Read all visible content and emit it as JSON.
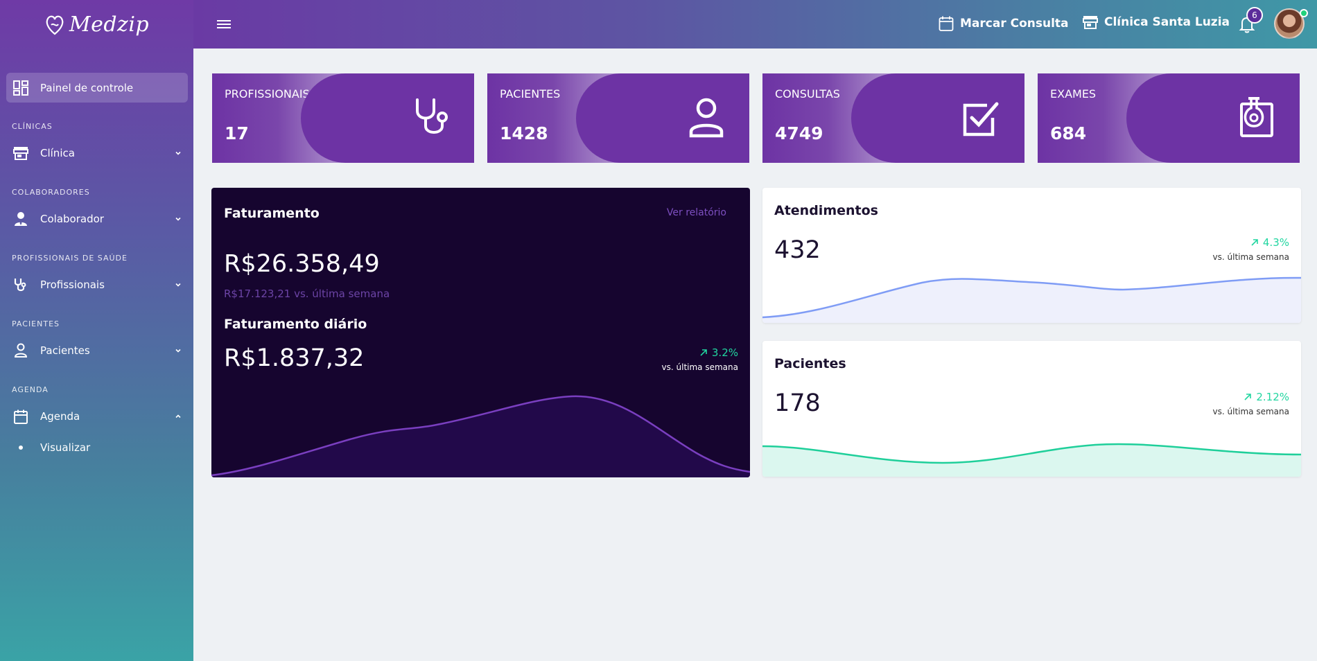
{
  "brand": {
    "name": "Medzip"
  },
  "sidebar": {
    "active": {
      "label": "Painel de controle",
      "icon": "dashboard-icon"
    },
    "sections": [
      {
        "title": "CLÍNICAS",
        "item": "Clínica",
        "icon": "store-icon"
      },
      {
        "title": "COLABORADORES",
        "item": "Colaborador",
        "icon": "person-tie-icon"
      },
      {
        "title": "PROFISSIONAIS DE SAÚDE",
        "item": "Profissionais",
        "icon": "stethoscope-icon"
      },
      {
        "title": "PACIENTES",
        "item": "Pacientes",
        "icon": "person-icon"
      },
      {
        "title": "AGENDA",
        "item": "Agenda",
        "icon": "calendar-icon"
      }
    ],
    "sub_item": "Visualizar"
  },
  "topbar": {
    "schedule_label": "Marcar Consulta",
    "clinic_label": "Clínica Santa Luzia",
    "notifications_count": "6"
  },
  "stats": [
    {
      "title": "PROFISSIONAIS",
      "value": "17",
      "icon": "stethoscope-icon"
    },
    {
      "title": "PACIENTES",
      "value": "1428",
      "icon": "person-icon"
    },
    {
      "title": "CONSULTAS",
      "value": "4749",
      "icon": "checkbox-icon"
    },
    {
      "title": "EXAMES",
      "value": "684",
      "icon": "flask-icon"
    }
  ],
  "faturamento": {
    "title": "Faturamento",
    "link": "Ver relatório",
    "amount": "R$26.358,49",
    "compare": "R$17.123,21 vs. última semana",
    "daily_title": "Faturamento diário",
    "daily_amount": "R$1.837,32",
    "pct": "3.2%",
    "vs": "vs. última semana"
  },
  "atendimentos": {
    "title": "Atendimentos",
    "value": "432",
    "pct": "4.3%",
    "vs": "vs. última semana"
  },
  "pacientes": {
    "title": "Pacientes",
    "value": "178",
    "pct": "2.12%",
    "vs": "vs. última semana"
  },
  "colors": {
    "primary": "#6d33a4",
    "dark_card": "#16052f",
    "success": "#21d6a0",
    "line_blue": "#7f9cf5",
    "line_green": "#1fcf9a"
  }
}
